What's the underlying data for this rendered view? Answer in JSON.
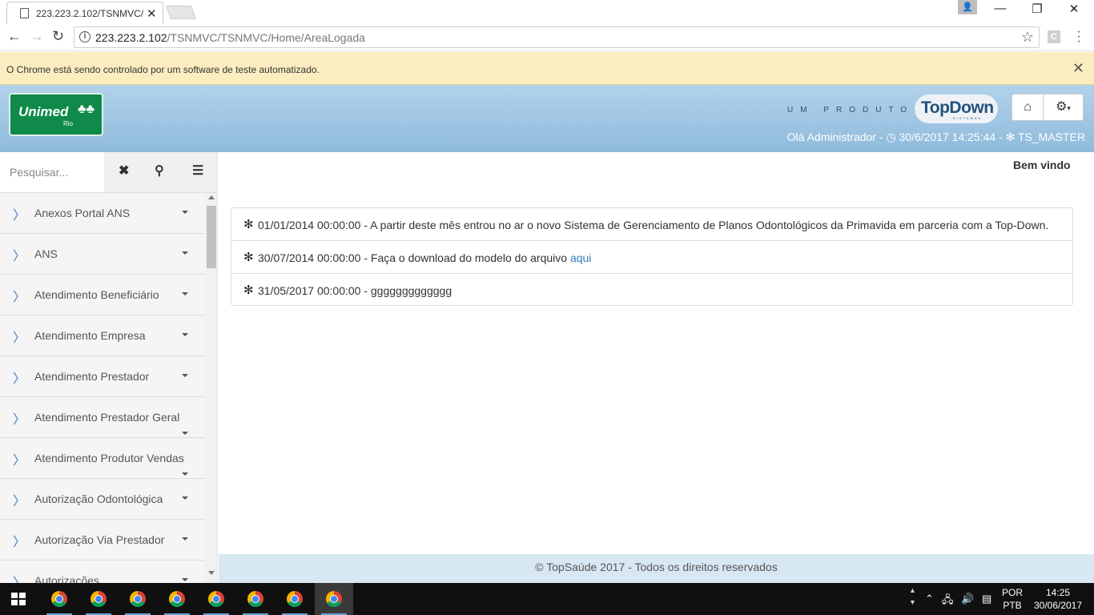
{
  "browser": {
    "tab_title": "223.223.2.102/TSNMVC/",
    "url_host": "223.223.2.102",
    "url_path": "/TSNMVC/TSNMVC/Home/AreaLogada",
    "infobar_text": "O Chrome está sendo controlado por um software de teste automatizado.",
    "ext_letter": "C"
  },
  "header": {
    "logo_text": "Unimed",
    "logo_sub": "Rio",
    "product_label": "UM PRODUTO:",
    "brand": "TopDown",
    "brand_sub": "SISTEMAS",
    "greeting": "Olá Administrador - ",
    "datetime": "30/6/2017 14:25:44 - ",
    "user_code": "TS_MASTER"
  },
  "sidebar": {
    "search_placeholder": "Pesquisar...",
    "items": [
      {
        "label": "Anexos Portal ANS"
      },
      {
        "label": "ANS"
      },
      {
        "label": "Atendimento Beneficiário"
      },
      {
        "label": "Atendimento Empresa"
      },
      {
        "label": "Atendimento Prestador"
      },
      {
        "label": "Atendimento Prestador Geral"
      },
      {
        "label": "Atendimento Produtor Vendas"
      },
      {
        "label": "Autorização Odontológica"
      },
      {
        "label": "Autorização Via Prestador"
      },
      {
        "label": "Autorizações"
      }
    ]
  },
  "main": {
    "welcome": "Bem vindo",
    "news": [
      {
        "text": "01/01/2014 00:00:00 - A partir deste mês entrou no ar o novo Sistema de Gerenciamento de Planos Odontológicos da Primavida em parceria com a Top-Down."
      },
      {
        "text": "30/07/2014 00:00:00 - Faça o download do modelo do arquivo ",
        "link": "aqui"
      },
      {
        "text": "31/05/2017 00:00:00 - ggggggggggggg"
      }
    ],
    "footer": "© TopSaúde 2017 - Todos os direitos reservados"
  },
  "taskbar": {
    "lang_top": "POR",
    "lang_bottom": "PTB",
    "time": "14:25",
    "date": "30/06/2017"
  }
}
